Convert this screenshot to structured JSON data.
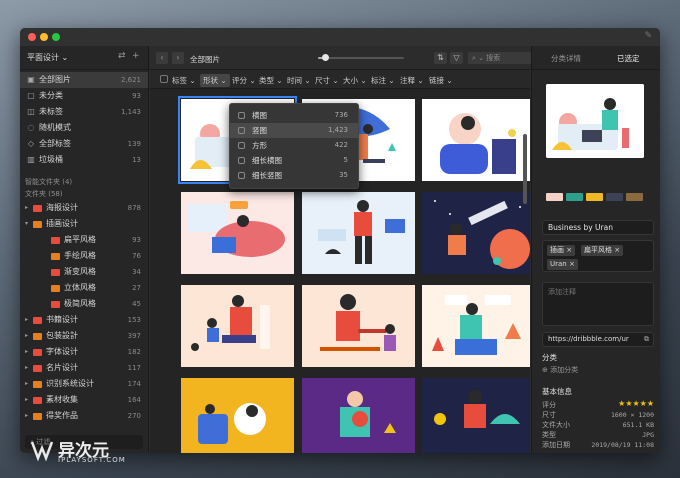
{
  "sidebar": {
    "library": "平面设计",
    "items": [
      {
        "icon": "all-images-icon",
        "glyph": "▣",
        "label": "全部图片",
        "count": "2,621"
      },
      {
        "icon": "uncategorized-icon",
        "glyph": "▢",
        "label": "未分类",
        "count": "93"
      },
      {
        "icon": "untagged-icon",
        "glyph": "◫",
        "label": "未标签",
        "count": "1,143"
      },
      {
        "icon": "random-icon",
        "glyph": "◌",
        "label": "随机模式",
        "count": ""
      },
      {
        "icon": "all-tags-icon",
        "glyph": "◇",
        "label": "全部标签",
        "count": "139"
      },
      {
        "icon": "trash-icon",
        "glyph": "▥",
        "label": "垃圾桶",
        "count": "13"
      }
    ],
    "smart_folders": "智能文件夹 (4)",
    "folders_title": "文件夹 (58)",
    "folders": [
      {
        "label": "海报设计",
        "count": "878",
        "color": "#e74c3c",
        "level": 0,
        "open": false
      },
      {
        "label": "插画设计",
        "count": "",
        "color": "#e67e22",
        "level": 0,
        "open": true
      },
      {
        "label": "扁平风格",
        "count": "93",
        "color": "#e74c3c",
        "level": 1,
        "open": false
      },
      {
        "label": "手绘风格",
        "count": "76",
        "color": "#e67e22",
        "level": 1,
        "open": false
      },
      {
        "label": "渐变风格",
        "count": "34",
        "color": "#e74c3c",
        "level": 1,
        "open": false
      },
      {
        "label": "立体风格",
        "count": "27",
        "color": "#e67e22",
        "level": 1,
        "open": false
      },
      {
        "label": "极简风格",
        "count": "45",
        "color": "#e74c3c",
        "level": 1,
        "open": false
      },
      {
        "label": "书籍设计",
        "count": "153",
        "color": "#e74c3c",
        "level": 0,
        "open": false
      },
      {
        "label": "包装設計",
        "count": "397",
        "color": "#e67e22",
        "level": 0,
        "open": false
      },
      {
        "label": "字体设计",
        "count": "182",
        "color": "#e74c3c",
        "level": 0,
        "open": false
      },
      {
        "label": "名片设计",
        "count": "117",
        "color": "#e74c3c",
        "level": 0,
        "open": false
      },
      {
        "label": "识别系统设计",
        "count": "174",
        "color": "#e67e22",
        "level": 0,
        "open": false
      },
      {
        "label": "素材收集",
        "count": "164",
        "color": "#e74c3c",
        "level": 0,
        "open": false
      },
      {
        "label": "得奖作品",
        "count": "270",
        "color": "#e67e22",
        "level": 0,
        "open": false
      }
    ],
    "search_placeholder": "过滤"
  },
  "toolbar": {
    "breadcrumb": "全部图片",
    "zoom_level": 0.08,
    "search_placeholder": "搜索"
  },
  "filters": [
    "标签",
    "形状",
    "评分",
    "类型",
    "时间",
    "尺寸",
    "大小",
    "标注",
    "注释",
    "链接"
  ],
  "active_filter": "形状",
  "shape_dropdown": [
    {
      "label": "横图",
      "count": "736"
    },
    {
      "label": "竖图",
      "count": "1,423"
    },
    {
      "label": "方形",
      "count": "422"
    },
    {
      "label": "细长横图",
      "count": "5"
    },
    {
      "label": "细长竖图",
      "count": "35"
    }
  ],
  "right_panel": {
    "tabs": [
      "分类详情",
      "已选定"
    ],
    "swatches": [
      "#f6d2c6",
      "#2e9e8d",
      "#f0b825",
      "#3d4256",
      "#8a6a3e"
    ],
    "title": "Business by Uran",
    "tags": [
      "插画",
      "扁平风格",
      "Uran"
    ],
    "note_placeholder": "添加注释",
    "url": "https://dribbble.com/ur",
    "category_title": "分类",
    "add_category": "添加分类",
    "info_title": "基本信息",
    "info": [
      {
        "k": "评分",
        "v": ""
      },
      {
        "k": "尺寸",
        "v": "1600 × 1200"
      },
      {
        "k": "文件大小",
        "v": "651.1 KB"
      },
      {
        "k": "类型",
        "v": "JPG"
      },
      {
        "k": "添加日期",
        "v": "2019/08/19 11:08"
      }
    ],
    "rating": 5
  },
  "watermark": {
    "cn": "异次元",
    "en": "IPLAYSOFT.COM"
  }
}
